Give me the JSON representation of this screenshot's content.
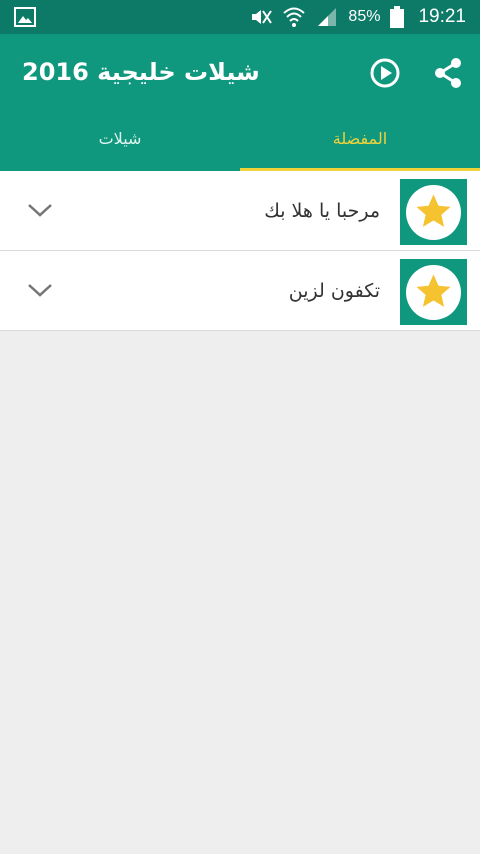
{
  "status_bar": {
    "battery": "85%",
    "time": "19:21"
  },
  "app_bar": {
    "title": "شيلات خليجية 2016",
    "icons": [
      "play-circle-icon",
      "share-icon"
    ]
  },
  "tabs": [
    {
      "label": "شيلات",
      "active": false
    },
    {
      "label": "المفضلة",
      "active": true
    }
  ],
  "list": {
    "items": [
      {
        "label": "مرحبا يا هلا بك",
        "icon": "star-icon"
      },
      {
        "label": "تكفون لزين",
        "icon": "star-icon"
      }
    ]
  },
  "colors": {
    "status_bar": "#0d7a67",
    "app_bar": "#10987e",
    "accent": "#f1d23a",
    "background": "#eeeeee"
  }
}
